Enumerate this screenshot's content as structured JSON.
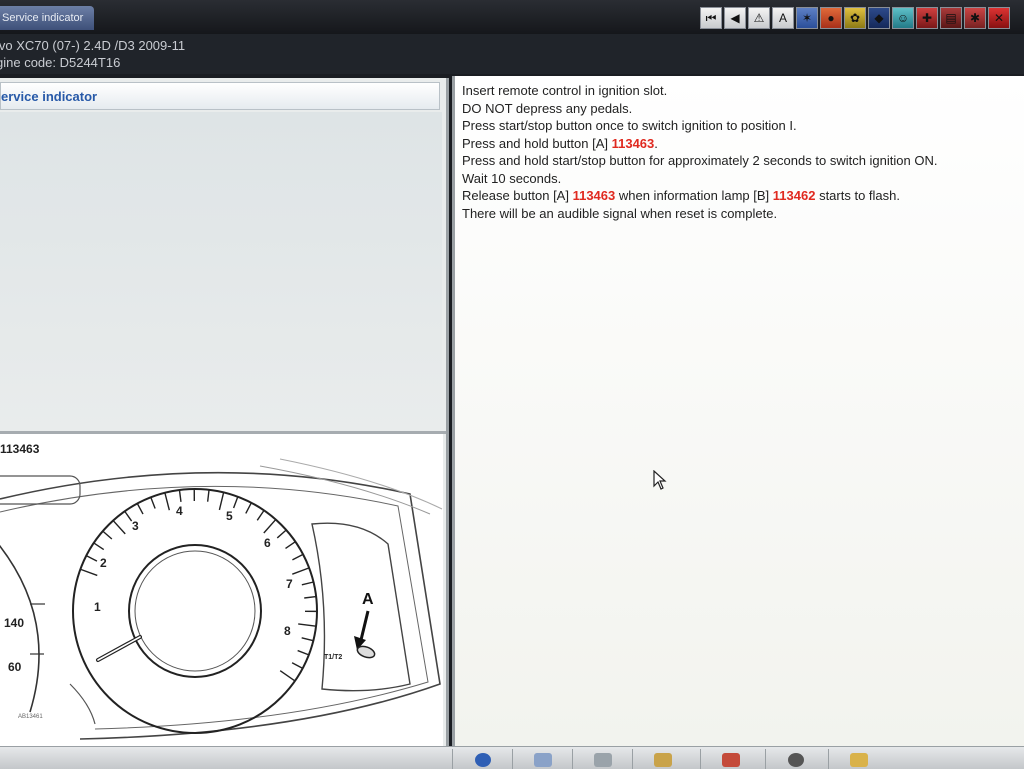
{
  "window": {
    "title": "Service indicator"
  },
  "toolbar": {
    "buttons": [
      {
        "name": "first-page-icon",
        "glyph": "⏮"
      },
      {
        "name": "previous-icon",
        "glyph": "◀"
      },
      {
        "name": "warning-icon",
        "glyph": "⚠"
      },
      {
        "name": "abc-icon",
        "glyph": "A"
      },
      {
        "name": "network-icon",
        "glyph": "✶"
      },
      {
        "name": "diagnostics-icon",
        "glyph": "●"
      },
      {
        "name": "car-parts-icon",
        "glyph": "✿"
      },
      {
        "name": "shield-icon",
        "glyph": "◆"
      },
      {
        "name": "person-icon",
        "glyph": "☺"
      },
      {
        "name": "tools-icon",
        "glyph": "✚"
      },
      {
        "name": "document-icon",
        "glyph": "▤"
      },
      {
        "name": "settings-icon",
        "glyph": "✱"
      },
      {
        "name": "exit-icon",
        "glyph": "✕"
      }
    ]
  },
  "vehicle": {
    "model": "lvo   XC70 (07-) 2.4D /D3 2009-11",
    "engine": "gine code: D5244T16"
  },
  "left_panel": {
    "header": "ervice indicator",
    "image_label": "113463",
    "gauge": {
      "tacho_numbers": [
        "1",
        "2",
        "3",
        "4",
        "5",
        "6",
        "7",
        "8"
      ],
      "speedo_numbers": [
        "140",
        "60"
      ],
      "button_label": "A",
      "button_text": "T1/T2",
      "small_print": "AB13461"
    }
  },
  "instructions": [
    {
      "text": "Insert remote control in ignition slot."
    },
    {
      "text": "DO NOT depress any pedals."
    },
    {
      "text": "Press start/stop button once to switch ignition to position I."
    },
    {
      "pre": "Press and hold button [A] ",
      "ref": "113463",
      "post": "."
    },
    {
      "text": "Press and hold start/stop button for approximately 2 seconds to switch ignition ON."
    },
    {
      "text": "Wait 10 seconds."
    },
    {
      "pre": "Release button [A] ",
      "ref": "113463",
      "mid": " when information lamp [B] ",
      "ref2": "113462",
      "post": " starts to flash."
    },
    {
      "text": "There will be an audible signal when reset is complete."
    }
  ],
  "colors": {
    "reference": "#e02a20",
    "header_text": "#2759a8"
  }
}
